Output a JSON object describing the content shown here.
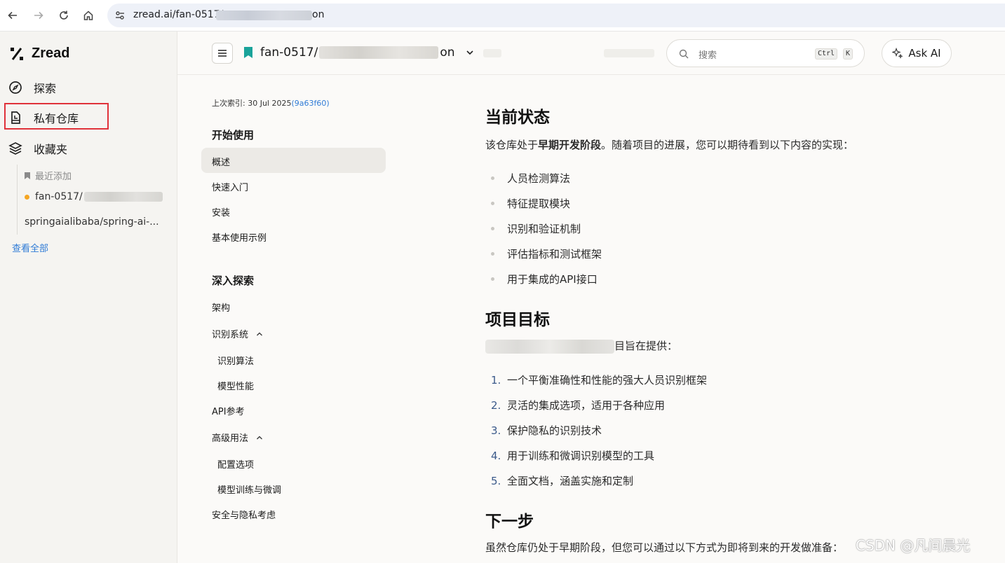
{
  "browser": {
    "url_prefix": "zread.ai/fan-0517/",
    "url_suffix": "on"
  },
  "sidebar": {
    "brand": "Zread",
    "items": [
      {
        "label": "探索",
        "icon": "compass-icon"
      },
      {
        "label": "私有仓库",
        "icon": "repo-icon"
      },
      {
        "label": "收藏夹",
        "icon": "layers-icon"
      }
    ],
    "recent_label": "最近添加",
    "recent_repos": [
      "fan-0517/",
      "springaialibaba/spring-ai-..."
    ],
    "view_all": "查看全部",
    "accent_dot": "#f5a623"
  },
  "header": {
    "repo_prefix": "fan-0517/",
    "repo_suffix": "on",
    "search_placeholder": "搜索",
    "shortcut_ctrl": "Ctrl",
    "shortcut_k": "K",
    "ask_ai": "Ask AI"
  },
  "toc": {
    "last_indexed": "上次索引: 30 Jul 2025",
    "commit": "(9a63f60)",
    "section1": "开始使用",
    "s1_items": [
      "概述",
      "快速入门",
      "安装",
      "基本使用示例"
    ],
    "section2": "深入探索",
    "s2_items": {
      "arch": "架构",
      "recog": "识别系统",
      "recog_alg": "识别算法",
      "model_perf": "模型性能",
      "api": "API参考",
      "advanced": "高级用法",
      "config": "配置选项",
      "training": "模型训练与微调",
      "security": "安全与隐私考虑"
    }
  },
  "article": {
    "h_status": "当前状态",
    "status_p1": "该仓库处于",
    "status_bold": "早期开发阶段",
    "status_p2": "。随着项目的进展，您可以期待看到以下内容的实现：",
    "status_list": [
      "人员检测算法",
      "特征提取模块",
      "识别和验证机制",
      "评估指标和测试框架",
      "用于集成的API接口"
    ],
    "h_goals": "项目目标",
    "goals_p": "目旨在提供：",
    "goals_list": [
      "一个平衡准确性和性能的强大人员识别框架",
      "灵活的集成选项，适用于各种应用",
      "保护隐私的识别技术",
      "用于训练和微调识别模型的工具",
      "全面文档，涵盖实施和定制"
    ],
    "h_next": "下一步",
    "next_p": "虽然仓库仍处于早期阶段，但您可以通过以下方式为即将到来的开发做准备："
  },
  "watermark": "CSDN @凡间晨光"
}
